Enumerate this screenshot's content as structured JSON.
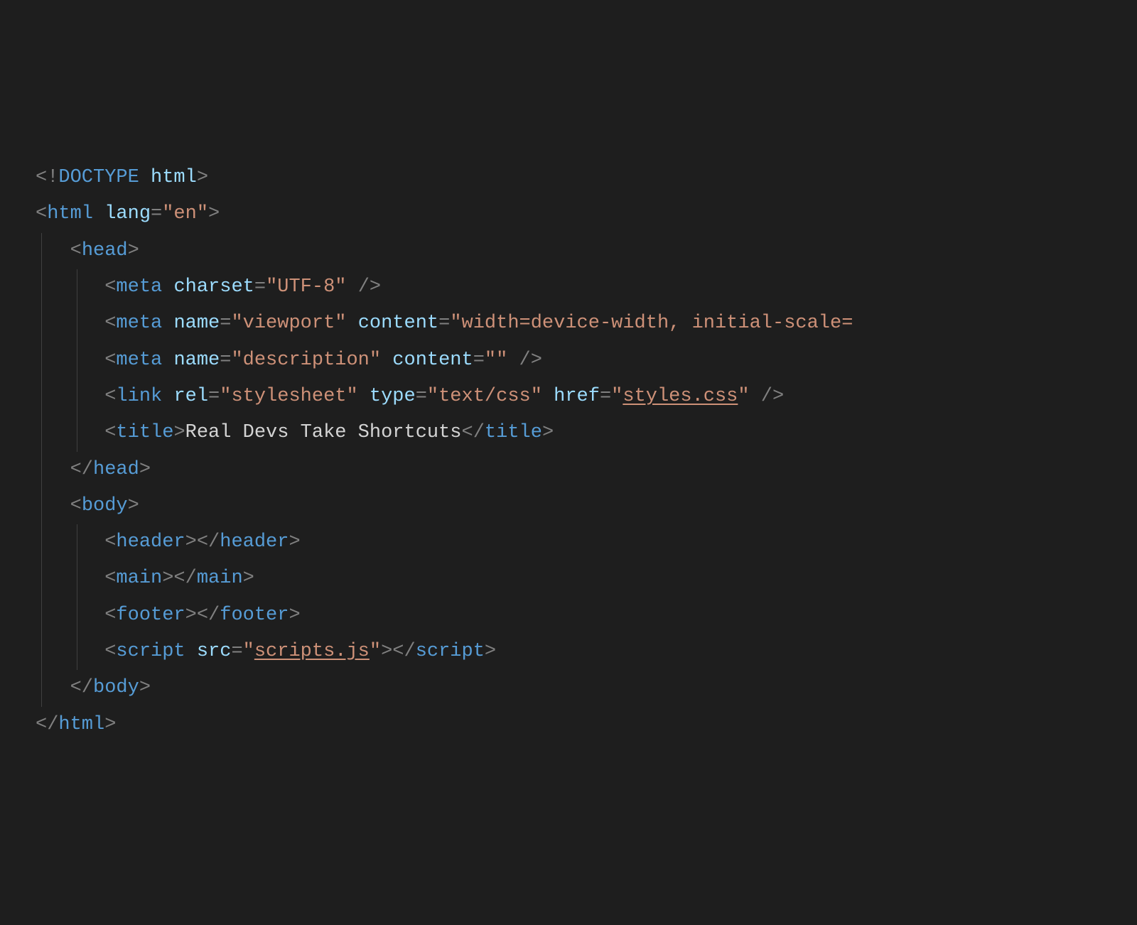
{
  "code": {
    "lines": [
      {
        "indent": 0,
        "tokens": [
          {
            "type": "punct",
            "text": "<!"
          },
          {
            "type": "doctype-kw",
            "text": "DOCTYPE"
          },
          {
            "type": "text",
            "text": " "
          },
          {
            "type": "attr-name",
            "text": "html"
          },
          {
            "type": "punct",
            "text": ">"
          }
        ]
      },
      {
        "indent": 0,
        "tokens": [
          {
            "type": "punct",
            "text": "<"
          },
          {
            "type": "tag",
            "text": "html"
          },
          {
            "type": "text",
            "text": " "
          },
          {
            "type": "attr-name",
            "text": "lang"
          },
          {
            "type": "punct",
            "text": "="
          },
          {
            "type": "attr-value",
            "text": "\"en\""
          },
          {
            "type": "punct",
            "text": ">"
          }
        ]
      },
      {
        "indent": 1,
        "guides": [
          1
        ],
        "tokens": [
          {
            "type": "punct",
            "text": "<"
          },
          {
            "type": "tag",
            "text": "head"
          },
          {
            "type": "punct",
            "text": ">"
          }
        ]
      },
      {
        "indent": 2,
        "guides": [
          1,
          2
        ],
        "tokens": [
          {
            "type": "punct",
            "text": "<"
          },
          {
            "type": "tag",
            "text": "meta"
          },
          {
            "type": "text",
            "text": " "
          },
          {
            "type": "attr-name",
            "text": "charset"
          },
          {
            "type": "punct",
            "text": "="
          },
          {
            "type": "attr-value",
            "text": "\"UTF-8\""
          },
          {
            "type": "text",
            "text": " "
          },
          {
            "type": "punct",
            "text": "/>"
          }
        ]
      },
      {
        "indent": 2,
        "guides": [
          1,
          2
        ],
        "tokens": [
          {
            "type": "punct",
            "text": "<"
          },
          {
            "type": "tag",
            "text": "meta"
          },
          {
            "type": "text",
            "text": " "
          },
          {
            "type": "attr-name",
            "text": "name"
          },
          {
            "type": "punct",
            "text": "="
          },
          {
            "type": "attr-value",
            "text": "\"viewport\""
          },
          {
            "type": "text",
            "text": " "
          },
          {
            "type": "attr-name",
            "text": "content"
          },
          {
            "type": "punct",
            "text": "="
          },
          {
            "type": "attr-value",
            "text": "\"width=device-width, initial-scale="
          }
        ]
      },
      {
        "indent": 2,
        "guides": [
          1,
          2
        ],
        "tokens": [
          {
            "type": "punct",
            "text": "<"
          },
          {
            "type": "tag",
            "text": "meta"
          },
          {
            "type": "text",
            "text": " "
          },
          {
            "type": "attr-name",
            "text": "name"
          },
          {
            "type": "punct",
            "text": "="
          },
          {
            "type": "attr-value",
            "text": "\"description\""
          },
          {
            "type": "text",
            "text": " "
          },
          {
            "type": "attr-name",
            "text": "content"
          },
          {
            "type": "punct",
            "text": "="
          },
          {
            "type": "attr-value",
            "text": "\"\""
          },
          {
            "type": "text",
            "text": " "
          },
          {
            "type": "punct",
            "text": "/>"
          }
        ]
      },
      {
        "indent": 2,
        "guides": [
          1,
          2
        ],
        "tokens": [
          {
            "type": "punct",
            "text": "<"
          },
          {
            "type": "tag",
            "text": "link"
          },
          {
            "type": "text",
            "text": " "
          },
          {
            "type": "attr-name",
            "text": "rel"
          },
          {
            "type": "punct",
            "text": "="
          },
          {
            "type": "attr-value",
            "text": "\"stylesheet\""
          },
          {
            "type": "text",
            "text": " "
          },
          {
            "type": "attr-name",
            "text": "type"
          },
          {
            "type": "punct",
            "text": "="
          },
          {
            "type": "attr-value",
            "text": "\"text/css\""
          },
          {
            "type": "text",
            "text": " "
          },
          {
            "type": "attr-name",
            "text": "href"
          },
          {
            "type": "punct",
            "text": "="
          },
          {
            "type": "attr-value-q",
            "text": "\""
          },
          {
            "type": "attr-value-link",
            "text": "styles.css"
          },
          {
            "type": "attr-value-q",
            "text": "\""
          },
          {
            "type": "text",
            "text": " "
          },
          {
            "type": "punct",
            "text": "/>"
          }
        ]
      },
      {
        "indent": 2,
        "guides": [
          1,
          2
        ],
        "tokens": [
          {
            "type": "punct",
            "text": "<"
          },
          {
            "type": "tag",
            "text": "title"
          },
          {
            "type": "punct",
            "text": ">"
          },
          {
            "type": "text-content",
            "text": "Real Devs Take Shortcuts"
          },
          {
            "type": "punct",
            "text": "</"
          },
          {
            "type": "tag",
            "text": "title"
          },
          {
            "type": "punct",
            "text": ">"
          }
        ]
      },
      {
        "indent": 1,
        "guides": [
          1
        ],
        "tokens": [
          {
            "type": "punct",
            "text": "</"
          },
          {
            "type": "tag",
            "text": "head"
          },
          {
            "type": "punct",
            "text": ">"
          }
        ]
      },
      {
        "indent": 1,
        "guides": [
          1
        ],
        "tokens": [
          {
            "type": "punct",
            "text": "<"
          },
          {
            "type": "tag",
            "text": "body"
          },
          {
            "type": "punct",
            "text": ">"
          }
        ]
      },
      {
        "indent": 2,
        "guides": [
          1,
          2
        ],
        "tokens": [
          {
            "type": "punct",
            "text": "<"
          },
          {
            "type": "tag",
            "text": "header"
          },
          {
            "type": "punct",
            "text": "></"
          },
          {
            "type": "tag",
            "text": "header"
          },
          {
            "type": "punct",
            "text": ">"
          }
        ]
      },
      {
        "indent": 2,
        "guides": [
          1,
          2
        ],
        "tokens": [
          {
            "type": "punct",
            "text": "<"
          },
          {
            "type": "tag",
            "text": "main"
          },
          {
            "type": "punct",
            "text": "></"
          },
          {
            "type": "tag",
            "text": "main"
          },
          {
            "type": "punct",
            "text": ">"
          }
        ]
      },
      {
        "indent": 2,
        "guides": [
          1,
          2
        ],
        "tokens": [
          {
            "type": "punct",
            "text": "<"
          },
          {
            "type": "tag",
            "text": "footer"
          },
          {
            "type": "punct",
            "text": "></"
          },
          {
            "type": "tag",
            "text": "footer"
          },
          {
            "type": "punct",
            "text": ">"
          }
        ]
      },
      {
        "indent": 2,
        "guides": [
          1,
          2
        ],
        "tokens": [
          {
            "type": "punct",
            "text": "<"
          },
          {
            "type": "tag",
            "text": "script"
          },
          {
            "type": "text",
            "text": " "
          },
          {
            "type": "attr-name",
            "text": "src"
          },
          {
            "type": "punct",
            "text": "="
          },
          {
            "type": "attr-value-q",
            "text": "\""
          },
          {
            "type": "attr-value-link",
            "text": "scripts.js"
          },
          {
            "type": "attr-value-q",
            "text": "\""
          },
          {
            "type": "punct",
            "text": "></"
          },
          {
            "type": "tag",
            "text": "script"
          },
          {
            "type": "punct",
            "text": ">"
          }
        ]
      },
      {
        "indent": 1,
        "guides": [
          1
        ],
        "tokens": [
          {
            "type": "punct",
            "text": "</"
          },
          {
            "type": "tag",
            "text": "body"
          },
          {
            "type": "punct",
            "text": ">"
          }
        ]
      },
      {
        "indent": 0,
        "tokens": [
          {
            "type": "punct",
            "text": "</"
          },
          {
            "type": "tag",
            "text": "html"
          },
          {
            "type": "punct",
            "text": ">"
          }
        ]
      }
    ]
  },
  "colors": {
    "background": "#1e1e1e",
    "punctuation": "#808080",
    "tag": "#569cd6",
    "attribute_name": "#9cdcfe",
    "attribute_value": "#ce9178",
    "text": "#d4d4d4"
  }
}
